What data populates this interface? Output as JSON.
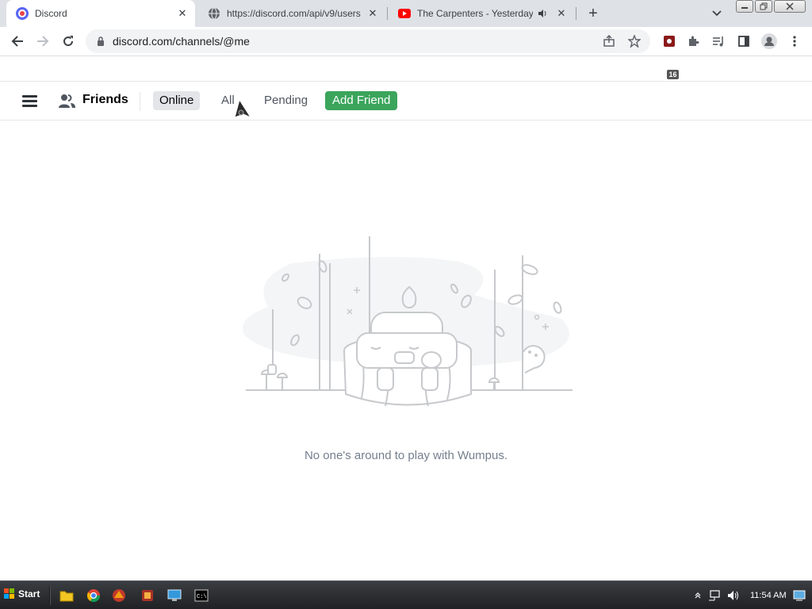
{
  "browser": {
    "tabs": [
      {
        "title": "Discord",
        "icon": "discord-favicon",
        "active": true
      },
      {
        "title": "https://discord.com/api/v9/users",
        "icon": "globe-icon",
        "active": false
      },
      {
        "title": "The Carpenters - Yesterday O",
        "icon": "youtube-icon",
        "active": false,
        "audio": true
      }
    ],
    "url": "discord.com/channels/@me",
    "extension_badge": "16",
    "window_buttons": [
      "minimize",
      "restore",
      "close"
    ]
  },
  "discord": {
    "header": {
      "title": "Friends",
      "tabs": [
        {
          "label": "Online",
          "selected": true
        },
        {
          "label": "All",
          "selected": false
        },
        {
          "label": "Pending",
          "selected": false
        }
      ],
      "add_friend_label": "Add Friend"
    },
    "empty_state": {
      "message": "No one's around to play with Wumpus."
    },
    "colors": {
      "add_friend": "#3ba55c",
      "selected_tab": "#e3e5e8",
      "muted_text": "#747f8d"
    }
  },
  "taskbar": {
    "start_label": "Start",
    "clock": "11:54 AM",
    "apps": [
      "folder-icon",
      "chrome-icon",
      "app-icon",
      "app-icon",
      "monitor-icon",
      "terminal-icon"
    ]
  }
}
